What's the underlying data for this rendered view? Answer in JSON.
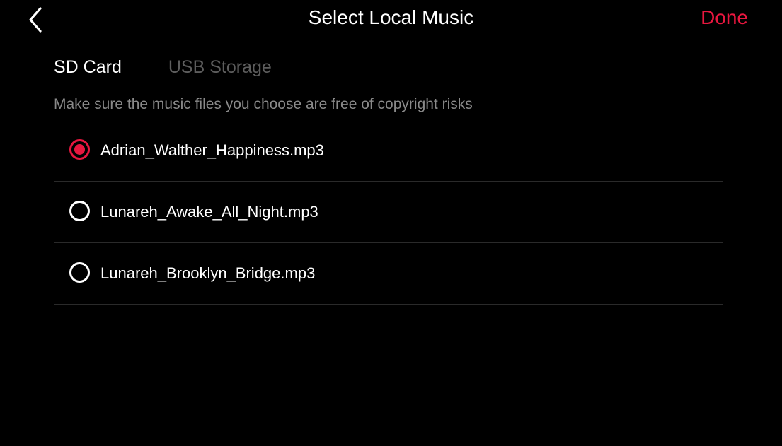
{
  "header": {
    "title": "Select Local Music",
    "done_label": "Done",
    "back_icon": "chevron-left-icon"
  },
  "tabs": [
    {
      "label": "SD Card",
      "active": true
    },
    {
      "label": "USB Storage",
      "active": false
    }
  ],
  "notice": "Make sure the music files you choose are free of copyright risks",
  "files": [
    {
      "name": "Adrian_Walther_Happiness.mp3",
      "selected": true
    },
    {
      "name": "Lunareh_Awake_All_Night.mp3",
      "selected": false
    },
    {
      "name": "Lunareh_Brooklyn_Bridge.mp3",
      "selected": false
    }
  ],
  "colors": {
    "background": "#000000",
    "accent": "#e8173f",
    "text": "#ffffff",
    "muted_text": "#8a8a8a",
    "inactive_tab": "#5d5d5d",
    "divider": "#2a2a2a"
  }
}
